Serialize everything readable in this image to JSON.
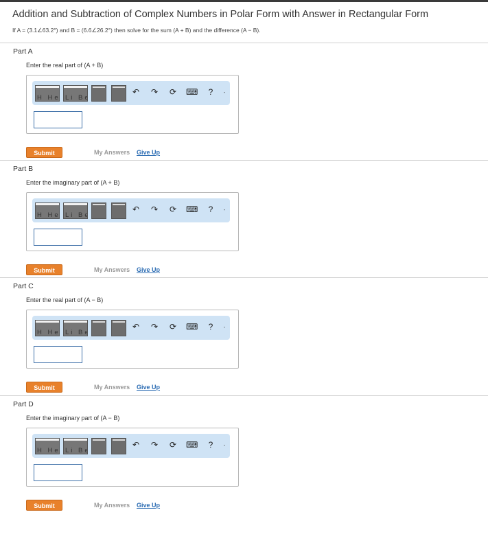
{
  "page": {
    "title": "Addition and Subtraction of Complex Numbers in Polar Form with Answer in Rectangular Form",
    "problem": "If A = (3.1∠63.2°) and B = (6.6∠26.2°) then solve for the sum (A + B) and the difference (A − B)."
  },
  "toolbar": {
    "template_labels": [
      "H  He",
      "Li  Be"
    ],
    "undo": "↶",
    "redo": "↷",
    "reset": "⟳",
    "keyboard": "⌨",
    "help": "?",
    "more": "-"
  },
  "parts": [
    {
      "title": "Part A",
      "prompt": "Enter the real part of (A + B)",
      "submit_label": "Submit",
      "my_answers_label": "My Answers",
      "give_up_label": "Give Up"
    },
    {
      "title": "Part B",
      "prompt": "Enter the imaginary part of (A + B)",
      "submit_label": "Submit",
      "my_answers_label": "My Answers",
      "give_up_label": "Give Up"
    },
    {
      "title": "Part C",
      "prompt": "Enter the real part of (A − B)",
      "submit_label": "Submit",
      "my_answers_label": "My Answers",
      "give_up_label": "Give Up"
    },
    {
      "title": "Part D",
      "prompt": "Enter the imaginary part of (A − B)",
      "submit_label": "Submit",
      "my_answers_label": "My Answers",
      "give_up_label": "Give Up"
    }
  ],
  "colors": {
    "submit": "#e8812b",
    "toolbar": "#cfe3f5",
    "link": "#2b6cb3"
  }
}
